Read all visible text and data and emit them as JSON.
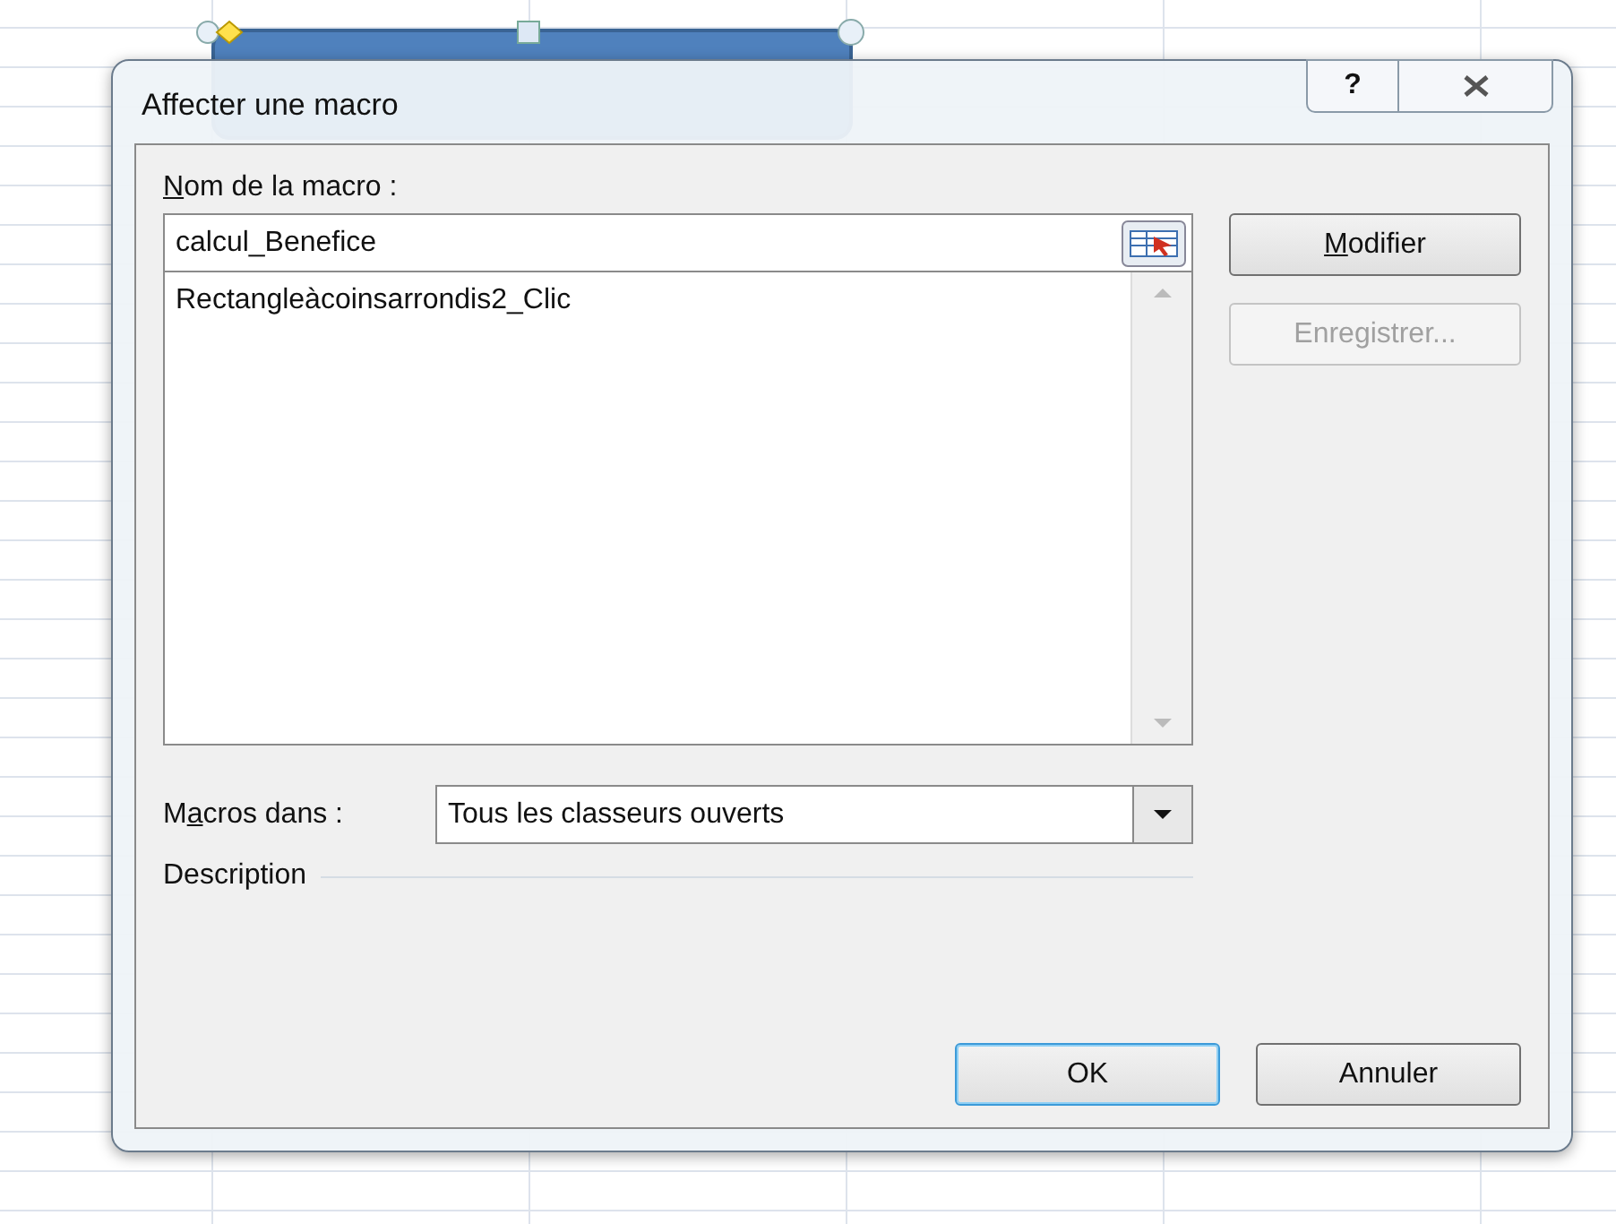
{
  "dialog": {
    "title": "Affecter une macro",
    "help_button": "?"
  },
  "macro_name": {
    "label": [
      {
        "text": "N",
        "underlined": true
      },
      {
        "text": "om de la macro :",
        "underlined": false
      }
    ],
    "value": "calcul_Benefice"
  },
  "macro_list": [
    {
      "name": "Rectangleàcoinsarrondis2_Clic",
      "selected": false
    }
  ],
  "side_buttons": [
    {
      "label": [
        {
          "text": "M",
          "underlined": true
        },
        {
          "text": "odifier",
          "underlined": false
        }
      ],
      "disabled": false
    },
    {
      "label": [
        {
          "text": "Enregistrer...",
          "underlined": false
        }
      ],
      "disabled": true
    }
  ],
  "macros_in": {
    "label": [
      {
        "text": "M",
        "underlined": false
      },
      {
        "text": "a",
        "underlined": true
      },
      {
        "text": "cros dans :",
        "underlined": false
      }
    ],
    "value": "Tous les classeurs ouverts"
  },
  "description": {
    "label": "Description"
  },
  "buttons": [
    {
      "label": "OK",
      "default": true
    },
    {
      "label": "Annuler",
      "default": false
    }
  ]
}
